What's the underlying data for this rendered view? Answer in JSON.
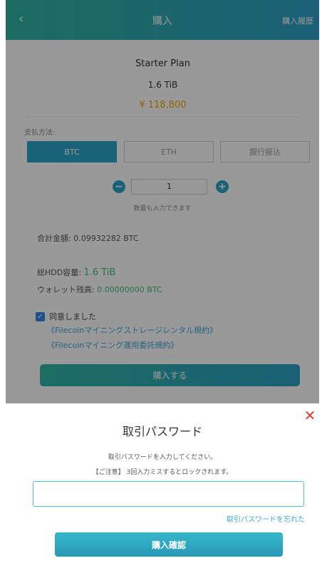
{
  "header": {
    "back_icon": "chevron-left-icon",
    "back_glyph": "‹",
    "title": "購入",
    "history": "購入履歴"
  },
  "plan": {
    "name": "Starter Plan",
    "size": "1.6 TiB",
    "price": "¥ 118,800"
  },
  "payment": {
    "label": "支払方法:",
    "methods": [
      "BTC",
      "ETH",
      "銀行振込"
    ],
    "selected": "BTC"
  },
  "quantity": {
    "minus": "−",
    "plus": "+",
    "value": "1",
    "hint": "数量も入力できます"
  },
  "totals": {
    "total_label": "合計金額:",
    "total_value": "0.09932282 BTC",
    "hdd_label": "総HDD容量:",
    "hdd_value": "1.6 TiB",
    "wallet_label": "ウォレット残高:",
    "wallet_value": "0.00000000 BTC"
  },
  "agreement": {
    "checkbox_glyph": "✓",
    "checked": true,
    "label": "同意しました",
    "terms1": "《Filecoinマイニングストレージレンタル規約》",
    "terms2": "《Filecoinマイニング運用委託規約》"
  },
  "buy_button": "購入する",
  "modal": {
    "close_glyph": "✕",
    "title": "取引パスワード",
    "description": "取引パスワードを入力してください。",
    "warning": "【ご注意】 3回入力ミスするとロックされます。",
    "password_value": "",
    "forgot": "取引パスワードを忘れた",
    "confirm": "購入確認"
  },
  "colors": {
    "accent": "#2aa6c9",
    "header_gradient_start": "#2fb3a2",
    "header_gradient_end": "#2f9fc6",
    "price": "#f0a500",
    "green_value": "#3dbf7b",
    "close": "#e53935"
  }
}
